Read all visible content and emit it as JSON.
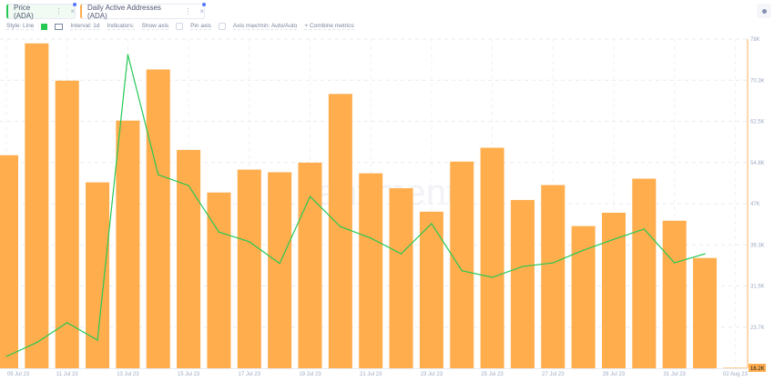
{
  "tabs": [
    {
      "label": "Price (ADA)",
      "color": "#26c953",
      "menu": "⋮",
      "close": "×"
    },
    {
      "label": "Daily Active Addresses (ADA)",
      "color": "#ffad4d",
      "menu": "⋮",
      "close": "×"
    }
  ],
  "toolbar": {
    "style": "Style: Line",
    "interval": "Interval: 1d",
    "indicators": "Indicators:",
    "show_axis": "Show axis",
    "pin_axis": "Pin axis",
    "axis_maxmin": "Axis max/min: Auto/Auto",
    "combine": "+ Combine metrics",
    "chevron": "⌄",
    "line_color": "#26c953"
  },
  "watermark": "santiment.",
  "chart_data": {
    "type": "bar+line",
    "dates": [
      "09 Jul 23",
      "10 Jul 23",
      "11 Jul 23",
      "12 Jul 23",
      "13 Jul 23",
      "14 Jul 23",
      "15 Jul 23",
      "16 Jul 23",
      "17 Jul 23",
      "18 Jul 23",
      "19 Jul 23",
      "20 Jul 23",
      "21 Jul 23",
      "22 Jul 23",
      "23 Jul 23",
      "24 Jul 23",
      "25 Jul 23",
      "26 Jul 23",
      "27 Jul 23",
      "28 Jul 23",
      "29 Jul 23",
      "30 Jul 23",
      "31 Jul 23",
      "01 Aug 23",
      "02 Aug 23"
    ],
    "x_tick_labels": [
      "09 Jul 23",
      "11 Jul 23",
      "13 Jul 23",
      "15 Jul 23",
      "17 Jul 23",
      "19 Jul 23",
      "21 Jul 23",
      "23 Jul 23",
      "25 Jul 23",
      "27 Jul 23",
      "29 Jul 23",
      "31 Jul 23",
      "02 Aug 23"
    ],
    "y_tick_labels": [
      "78K",
      "70.3K",
      "62.5K",
      "54.8K",
      "47K",
      "39.3K",
      "31.5K",
      "23.7K"
    ],
    "ylim": [
      16.2,
      78
    ],
    "last_value_label": "16.2K",
    "grid": true,
    "series": [
      {
        "name": "Daily Active Addresses (ADA)",
        "type": "bar",
        "color": "#ffad4d",
        "unit": "K",
        "values": [
          56.2,
          77.2,
          70.2,
          51.1,
          62.7,
          72.3,
          57.2,
          49.2,
          53.5,
          53.0,
          54.8,
          67.7,
          52.8,
          50.0,
          45.6,
          55.0,
          57.6,
          47.8,
          50.6,
          42.9,
          45.4,
          51.8,
          43.9,
          36.9,
          16.3
        ]
      },
      {
        "name": "Price (ADA)",
        "type": "line",
        "color": "#26c953",
        "axis_visible": false,
        "values": [
          0.28,
          0.2823,
          0.2856,
          0.2827,
          0.33,
          0.3101,
          0.3083,
          0.3006,
          0.299,
          0.2954,
          0.3065,
          0.3015,
          0.2996,
          0.297,
          0.302,
          0.2942,
          0.2931,
          0.2949,
          0.2955,
          0.2976,
          0.2994,
          0.3011,
          0.2955,
          0.297,
          null
        ]
      }
    ]
  }
}
